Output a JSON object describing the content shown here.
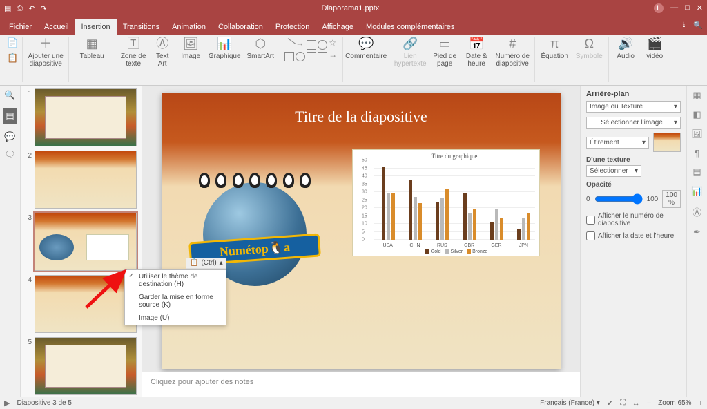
{
  "titlebar": {
    "filename": "Diaporama1.pptx"
  },
  "tabs": {
    "fichier": "Fichier",
    "accueil": "Accueil",
    "insertion": "Insertion",
    "transitions": "Transitions",
    "animation": "Animation",
    "collaboration": "Collaboration",
    "protection": "Protection",
    "affichage": "Affichage",
    "modules": "Modules complémentaires"
  },
  "ribbon": {
    "ajouter": "Ajouter une\ndiapositive",
    "tableau": "Tableau",
    "zone": "Zone de\ntexte",
    "textart": "Text\nArt",
    "image": "Image",
    "graphique": "Graphique",
    "smartart": "SmartArt",
    "commentaire": "Commentaire",
    "lien": "Lien\nhypertexte",
    "pied": "Pied de\npage",
    "date": "Date &\nheure",
    "numero": "Numéro de\ndiapositive",
    "equation": "Équation",
    "symbole": "Symbole",
    "audio": "Audio",
    "video": "vidéo"
  },
  "slide": {
    "title": "Titre de la diapositive",
    "logo_text": "Numétop🐧a"
  },
  "chart_data": {
    "type": "bar",
    "title": "Titre du graphique",
    "categories": [
      "USA",
      "CHN",
      "RUS",
      "GBR",
      "GER",
      "JPN"
    ],
    "series": [
      {
        "name": "Gold",
        "color": "#6b3e1e",
        "values": [
          46,
          38,
          24,
          29,
          11,
          7
        ]
      },
      {
        "name": "Silver",
        "color": "#b9b9b9",
        "values": [
          29,
          27,
          26,
          17,
          19,
          14
        ]
      },
      {
        "name": "Bronze",
        "color": "#d98c2b",
        "values": [
          29,
          23,
          32,
          19,
          14,
          17
        ]
      }
    ],
    "ylim": [
      0,
      50
    ],
    "yticks": [
      0,
      5,
      10,
      15,
      20,
      25,
      30,
      35,
      40,
      45,
      50
    ]
  },
  "notes": {
    "placeholder": "Cliquez pour ajouter des notes"
  },
  "paste_options": {
    "button_label": "(Ctrl)",
    "opt1": "Utiliser le thème de destination (H)",
    "opt2": "Garder la mise en forme source (K)",
    "opt3": "Image (U)"
  },
  "rpanel": {
    "heading": "Arrière-plan",
    "fill_mode": "Image ou Texture",
    "select_image": "Sélectionner l'image",
    "stretch": "Étirement",
    "texture_label": "D'une texture",
    "texture_sel": "Sélectionner",
    "opacity_label": "Opacité",
    "opacity_min": "0",
    "opacity_max": "100",
    "opacity_value": "100 %",
    "chk_num": "Afficher le numéro de diapositive",
    "chk_date": "Afficher la date et l'heure"
  },
  "status": {
    "slide_of": "Diapositive 3 de 5",
    "language": "Français (France)",
    "zoom": "Zoom 65%"
  },
  "thumbs": {
    "count": 5,
    "selected": 3
  }
}
